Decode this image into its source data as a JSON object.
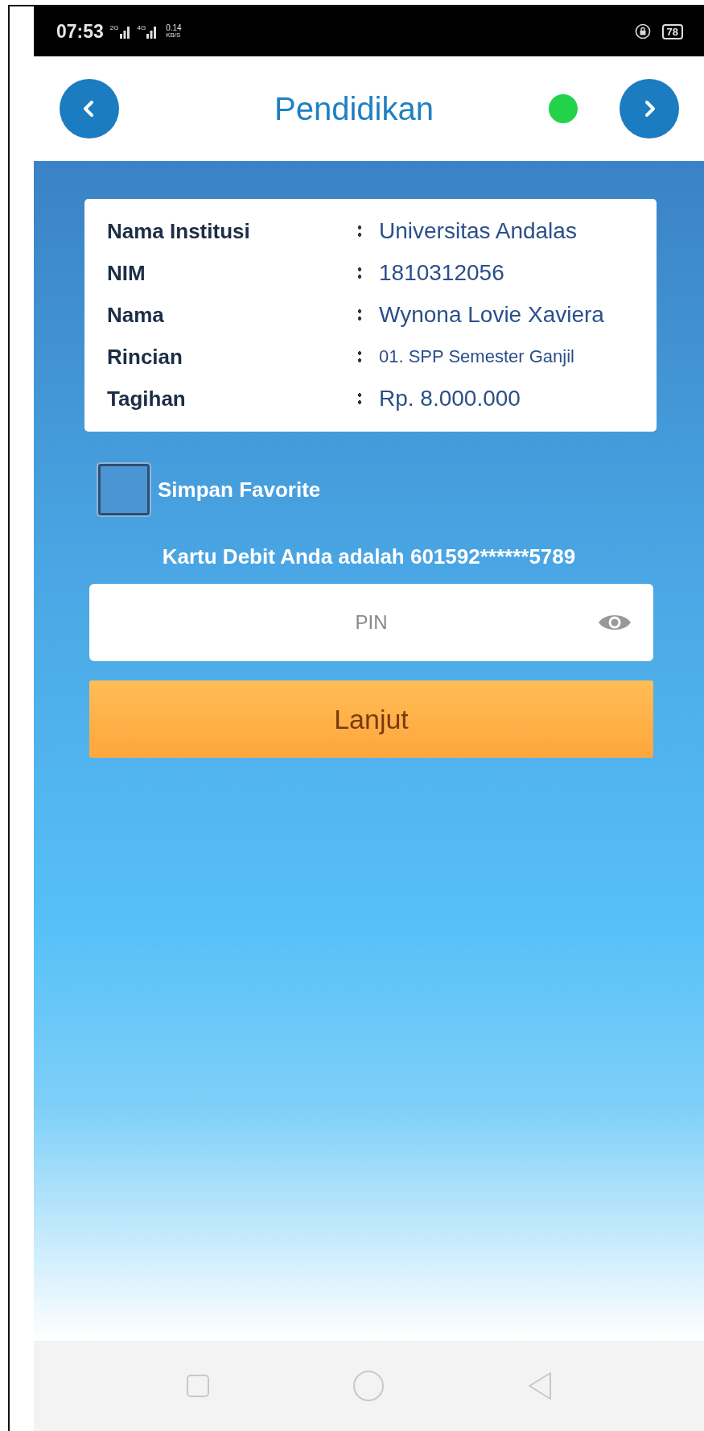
{
  "status_bar": {
    "time": "07:53",
    "sim_1": "2G",
    "sim_2": "4G",
    "speed_value": "0.14",
    "speed_unit": "KB/S",
    "battery": "78"
  },
  "header": {
    "title": "Pendidikan"
  },
  "details": [
    {
      "label": "Nama Institusi",
      "value": "Universitas Andalas"
    },
    {
      "label": "NIM",
      "value": "1810312056"
    },
    {
      "label": "Nama",
      "value": "Wynona Lovie Xaviera"
    },
    {
      "label": "Rincian",
      "value": "01. SPP Semester Ganjil"
    },
    {
      "label": "Tagihan",
      "value": "Rp. 8.000.000"
    }
  ],
  "favorite": {
    "label": "Simpan Favorite",
    "checked": false
  },
  "card_info": "Kartu Debit Anda adalah 601592******5789",
  "pin_field": {
    "placeholder": "PIN"
  },
  "buttons": [
    "Lanjut"
  ]
}
